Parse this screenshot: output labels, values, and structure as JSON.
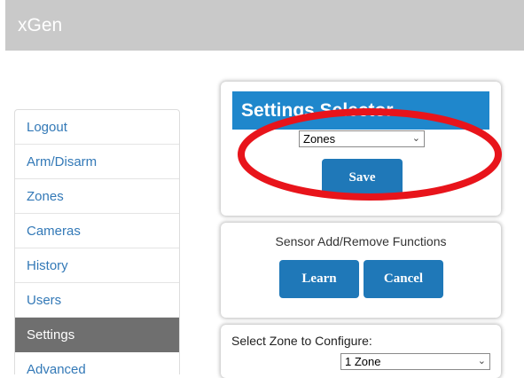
{
  "header": {
    "app_title": "xGen"
  },
  "sidebar": {
    "items": [
      {
        "label": "Logout",
        "active": false
      },
      {
        "label": "Arm/Disarm",
        "active": false
      },
      {
        "label": "Zones",
        "active": false
      },
      {
        "label": "Cameras",
        "active": false
      },
      {
        "label": "History",
        "active": false
      },
      {
        "label": "Users",
        "active": false
      },
      {
        "label": "Settings",
        "active": true
      },
      {
        "label": "Advanced",
        "active": false
      }
    ]
  },
  "settings_panel": {
    "title": "Settings Selector",
    "selected_option": "Zones",
    "save_label": "Save"
  },
  "functions_panel": {
    "title": "Sensor Add/Remove Functions",
    "learn_label": "Learn",
    "cancel_label": "Cancel"
  },
  "zone_panel": {
    "label": "Select Zone to Configure:",
    "selected_zone": "1 Zone"
  },
  "colors": {
    "accent": "#1f87cc",
    "button": "#1f78b8",
    "link": "#3379b7",
    "active_item": "#6f6f6f",
    "annotation": "#e8141b"
  },
  "annotation": {
    "shape": "ellipse",
    "color": "#e8141b",
    "target": "settings-selector"
  }
}
